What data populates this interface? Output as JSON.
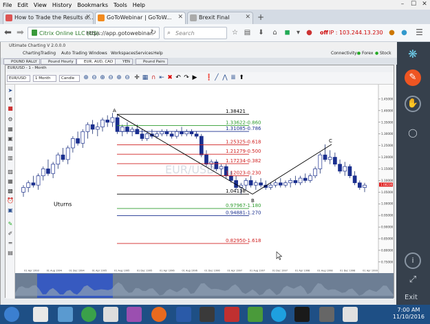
{
  "browser": {
    "menu": [
      "File",
      "Edit",
      "View",
      "History",
      "Bookmarks",
      "Tools",
      "Help"
    ],
    "window_controls": {
      "minimize": "–",
      "maximize": "☐",
      "close": "✕"
    },
    "tabs": [
      {
        "label": "How to Trade the Results o...",
        "fav_color": "#d55"
      },
      {
        "label": "GoToWebinar | GoToW...",
        "fav_color": "#f28a1d",
        "active": true
      },
      {
        "label": "Brexit Final",
        "fav_color": "#aaa"
      }
    ],
    "new_tab": "+",
    "url_org": "Citrix Online LLC (US)",
    "url": "https://app.gotowebinar.",
    "search_placeholder": "Search",
    "off_label": "off",
    "ip_label": "IP : 103.244.13.230"
  },
  "g2w": {
    "exit_label": "Exit"
  },
  "app": {
    "title": "Ultimate Charting V 2.0.0.0",
    "menu": [
      "Charting",
      "Trading",
      "Auto Trading",
      "Windows",
      "Workspaces",
      "Services",
      "Help"
    ],
    "connectivity_label": "Connectivity:",
    "conn_forex": "Forex",
    "conn_stock": "Stock",
    "window_tabs": [
      "POUND RALLY",
      "Pound Hourly",
      "EUR, AUD, CAD",
      "YEN",
      "Pound Pairs"
    ],
    "chart_header": "EUR/USD - 1 - Month",
    "symbol": "EUR/USD",
    "timeframe": "1 Month",
    "chart_style": "Candle"
  },
  "chart_data": {
    "type": "candlestick",
    "watermark": "EUR/USD",
    "note": "Uturns",
    "point_labels": [
      {
        "label": "A",
        "x": "Aug 1992",
        "y": 1.38421
      },
      {
        "label": "B",
        "x": "Oct 1997",
        "y": 1.04138
      },
      {
        "label": "C",
        "x": "Aug 2000",
        "y": 1.255
      }
    ],
    "fib_levels": [
      {
        "label": "1.38421",
        "value": 1.38421,
        "color": "#000000"
      },
      {
        "label": "1.33622-0.860",
        "value": 1.33622,
        "color": "#2e9b2e"
      },
      {
        "label": "1.31085-0.786",
        "value": 1.31085,
        "color": "#1a2f8f"
      },
      {
        "label": "1.25325-0.618",
        "value": 1.25325,
        "color": "#d02020"
      },
      {
        "label": "1.21279-0.500",
        "value": 1.21279,
        "color": "#d02020"
      },
      {
        "label": "1.17234-0.382",
        "value": 1.17234,
        "color": "#d02020"
      },
      {
        "label": "1.12023-0.230",
        "value": 1.12023,
        "color": "#d02020"
      },
      {
        "label": "1.04138",
        "value": 1.04138,
        "color": "#000000"
      },
      {
        "label": "0.97967-1.180",
        "value": 0.97967,
        "color": "#2e9b2e"
      },
      {
        "label": "0.94881-1.270",
        "value": 0.94881,
        "color": "#1a2f8f"
      },
      {
        "label": "0.82950-1.618",
        "value": 0.8295,
        "color": "#d02020"
      }
    ],
    "ylim": [
      0.72,
      1.5
    ],
    "yticks": [
      "1.45000",
      "1.40000",
      "1.35000",
      "1.30000",
      "1.25000",
      "1.20000",
      "1.15000",
      "1.10000",
      "1.05000",
      "1.00000",
      "0.95000",
      "0.90000",
      "0.85000",
      "0.80000",
      "0.75000"
    ],
    "current_price": "1.08230",
    "xticks": [
      "01 Apr 1993",
      "01 Aug 1994",
      "01 Dec 1994",
      "01 Apr 1995",
      "01 Aug 1995",
      "01 Dec 1995",
      "01 Apr 1996",
      "01 Aug 1996",
      "01 Dec 1996",
      "01 Apr 1997",
      "01 Aug 1997",
      "01 Dec 1997",
      "01 Apr 1998",
      "01 Aug 1998",
      "01 Dec 1998",
      "01 Apr 1999"
    ],
    "candles": [
      [
        1.05,
        1.08,
        1.03,
        1.07
      ],
      [
        1.07,
        1.1,
        1.05,
        1.09
      ],
      [
        1.09,
        1.12,
        1.07,
        1.08
      ],
      [
        1.08,
        1.13,
        1.06,
        1.12
      ],
      [
        1.12,
        1.16,
        1.1,
        1.15
      ],
      [
        1.15,
        1.19,
        1.12,
        1.13
      ],
      [
        1.13,
        1.18,
        1.11,
        1.17
      ],
      [
        1.17,
        1.22,
        1.15,
        1.21
      ],
      [
        1.21,
        1.24,
        1.18,
        1.19
      ],
      [
        1.19,
        1.25,
        1.17,
        1.24
      ],
      [
        1.24,
        1.29,
        1.22,
        1.28
      ],
      [
        1.28,
        1.31,
        1.25,
        1.26
      ],
      [
        1.26,
        1.32,
        1.24,
        1.31
      ],
      [
        1.31,
        1.35,
        1.28,
        1.34
      ],
      [
        1.34,
        1.36,
        1.3,
        1.32
      ],
      [
        1.32,
        1.35,
        1.29,
        1.33
      ],
      [
        1.33,
        1.37,
        1.31,
        1.36
      ],
      [
        1.36,
        1.38,
        1.33,
        1.35
      ],
      [
        1.35,
        1.39,
        1.33,
        1.37
      ],
      [
        1.37,
        1.384,
        1.3,
        1.31
      ],
      [
        1.31,
        1.34,
        1.29,
        1.33
      ],
      [
        1.33,
        1.35,
        1.3,
        1.31
      ],
      [
        1.31,
        1.33,
        1.29,
        1.32
      ],
      [
        1.32,
        1.34,
        1.3,
        1.3
      ],
      [
        1.3,
        1.32,
        1.27,
        1.28
      ],
      [
        1.28,
        1.31,
        1.27,
        1.3
      ],
      [
        1.3,
        1.32,
        1.28,
        1.29
      ],
      [
        1.29,
        1.31,
        1.28,
        1.3
      ],
      [
        1.3,
        1.32,
        1.29,
        1.31
      ],
      [
        1.31,
        1.32,
        1.29,
        1.3
      ],
      [
        1.3,
        1.31,
        1.28,
        1.29
      ],
      [
        1.29,
        1.32,
        1.28,
        1.31
      ],
      [
        1.31,
        1.33,
        1.29,
        1.3
      ],
      [
        1.3,
        1.32,
        1.29,
        1.31
      ],
      [
        1.31,
        1.32,
        1.29,
        1.3
      ],
      [
        1.3,
        1.31,
        1.28,
        1.29
      ],
      [
        1.29,
        1.3,
        1.2,
        1.21
      ],
      [
        1.21,
        1.23,
        1.16,
        1.17
      ],
      [
        1.17,
        1.19,
        1.15,
        1.18
      ],
      [
        1.18,
        1.19,
        1.14,
        1.15
      ],
      [
        1.15,
        1.17,
        1.12,
        1.16
      ],
      [
        1.16,
        1.17,
        1.11,
        1.12
      ],
      [
        1.12,
        1.14,
        1.09,
        1.1
      ],
      [
        1.1,
        1.12,
        1.06,
        1.07
      ],
      [
        1.07,
        1.09,
        1.04,
        1.08
      ],
      [
        1.08,
        1.11,
        1.06,
        1.1
      ],
      [
        1.1,
        1.12,
        1.07,
        1.08
      ],
      [
        1.08,
        1.1,
        1.06,
        1.09
      ],
      [
        1.09,
        1.11,
        1.07,
        1.08
      ],
      [
        1.08,
        1.1,
        1.06,
        1.07
      ],
      [
        1.07,
        1.09,
        1.06,
        1.08
      ],
      [
        1.08,
        1.1,
        1.07,
        1.09
      ],
      [
        1.09,
        1.11,
        1.07,
        1.08
      ],
      [
        1.08,
        1.1,
        1.07,
        1.09
      ],
      [
        1.09,
        1.11,
        1.07,
        1.1
      ],
      [
        1.1,
        1.12,
        1.08,
        1.09
      ],
      [
        1.09,
        1.12,
        1.08,
        1.11
      ],
      [
        1.11,
        1.13,
        1.09,
        1.1
      ],
      [
        1.1,
        1.13,
        1.09,
        1.12
      ],
      [
        1.12,
        1.16,
        1.11,
        1.15
      ],
      [
        1.15,
        1.22,
        1.13,
        1.21
      ],
      [
        1.21,
        1.255,
        1.18,
        1.19
      ],
      [
        1.19,
        1.23,
        1.17,
        1.2
      ],
      [
        1.2,
        1.22,
        1.16,
        1.17
      ],
      [
        1.17,
        1.19,
        1.13,
        1.14
      ],
      [
        1.14,
        1.18,
        1.12,
        1.16
      ],
      [
        1.16,
        1.17,
        1.11,
        1.12
      ],
      [
        1.12,
        1.14,
        1.08,
        1.09
      ],
      [
        1.09,
        1.1,
        1.06,
        1.07
      ],
      [
        1.07,
        1.09,
        1.05,
        1.08
      ]
    ]
  },
  "taskbar": {
    "time": "7:00 AM",
    "date": "11/10/2016"
  }
}
